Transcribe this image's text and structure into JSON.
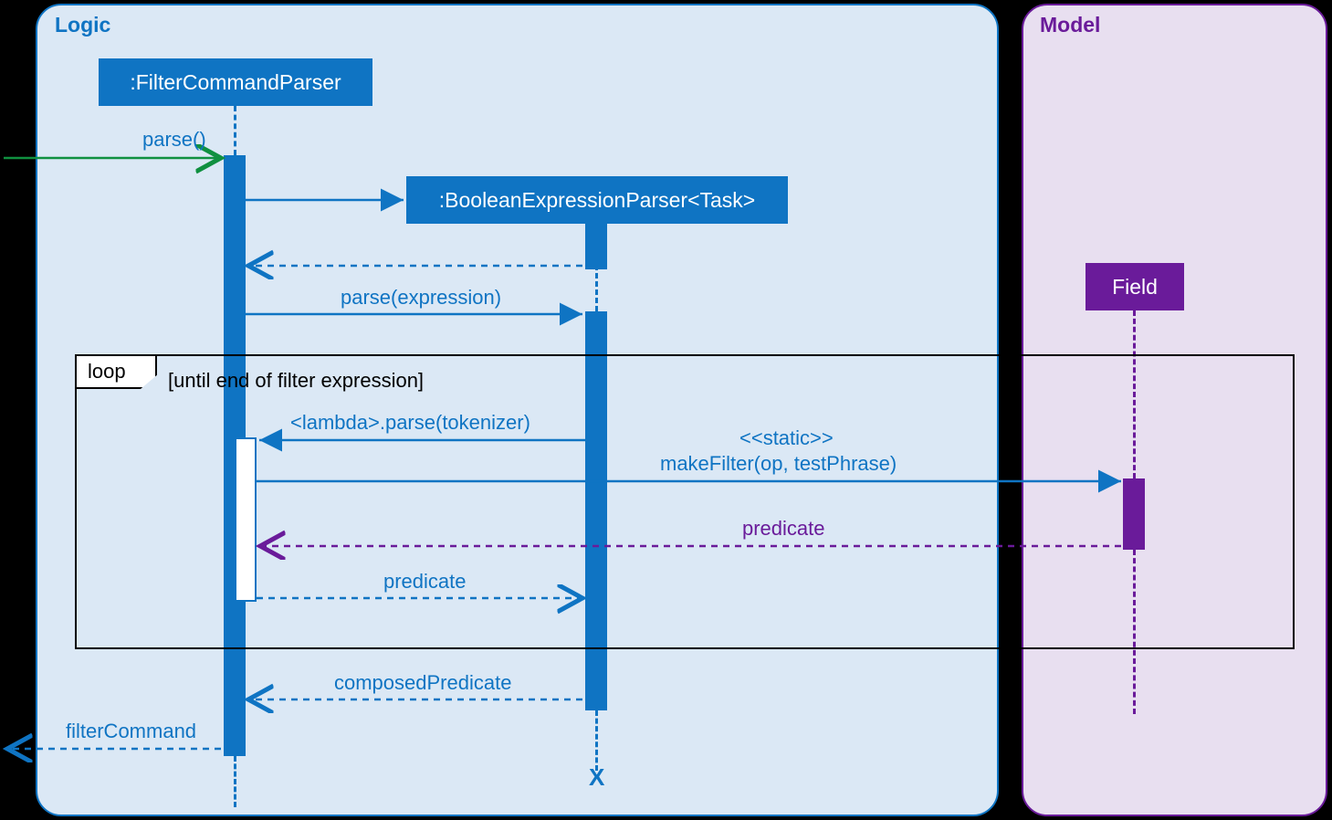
{
  "frames": {
    "logic": "Logic",
    "model": "Model"
  },
  "objects": {
    "filterParser": ":FilterCommandParser",
    "boolParser": ":BooleanExpressionParser<Task>",
    "field": "Field"
  },
  "messages": {
    "parse": "parse()",
    "parseExpr": "parse(expression)",
    "lambdaParse": "<lambda>.parse(tokenizer)",
    "staticStereo": "<<static>>",
    "makeFilter": "makeFilter(op, testPhrase)",
    "predicate1": "predicate",
    "predicate2": "predicate",
    "composed": "composedPredicate",
    "filterCmd": "filterCommand"
  },
  "loop": {
    "tag": "loop",
    "guard": "[until end of filter expression]"
  },
  "destroy": "X",
  "colors": {
    "blue": "#0f74c3",
    "purple": "#6a1b9a",
    "green": "#109040"
  }
}
